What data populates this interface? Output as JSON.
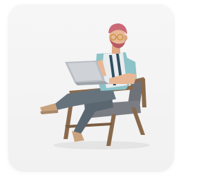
{
  "card": {
    "background": "#f3f3f3"
  },
  "illustration": {
    "icon": "person-with-laptop-in-armchair",
    "colors": {
      "hair": "#c96a76",
      "skin": "#e8b896",
      "glasses": "#c99645",
      "shirt": "#8bc3c7",
      "vest": "#2f4f5f",
      "pants": "#5a6670",
      "shoes": "#c9a27d",
      "laptop": "#b9bec4",
      "chair_wood": "#8a6a4c",
      "cushion": "#6f7278"
    }
  }
}
